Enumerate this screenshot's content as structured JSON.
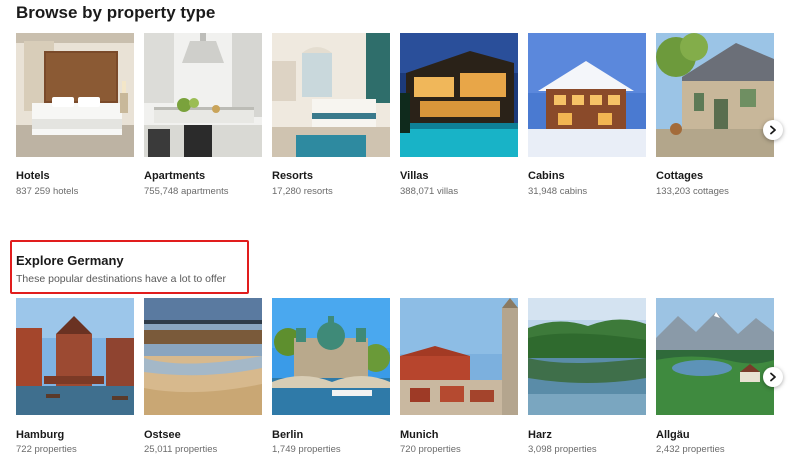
{
  "property_section": {
    "title": "Browse by property type",
    "cards": [
      {
        "name": "Hotels",
        "count": "837 259 hotels",
        "image": "hotel-room-photo"
      },
      {
        "name": "Apartments",
        "count": "755,748 apartments",
        "image": "apartment-kitchen-photo"
      },
      {
        "name": "Resorts",
        "count": "17,280 resorts",
        "image": "resort-room-photo"
      },
      {
        "name": "Villas",
        "count": "388,071 villas",
        "image": "villa-pool-night-photo"
      },
      {
        "name": "Cabins",
        "count": "31,948 cabins",
        "image": "snowy-cabin-photo"
      },
      {
        "name": "Cottages",
        "count": "133,203 cottages",
        "image": "stone-cottage-photo"
      }
    ],
    "next_icon": "chevron-right-icon"
  },
  "explore_section": {
    "title": "Explore Germany",
    "subtitle": "These popular destinations have a lot to offer",
    "highlight_color": "#e11d1d",
    "cards": [
      {
        "name": "Hamburg",
        "count": "722 properties",
        "image": "hamburg-photo"
      },
      {
        "name": "Ostsee",
        "count": "25,011 properties",
        "image": "ostsee-beach-photo"
      },
      {
        "name": "Berlin",
        "count": "1,749 properties",
        "image": "berlin-cathedral-photo"
      },
      {
        "name": "Munich",
        "count": "720 properties",
        "image": "munich-rooftops-photo"
      },
      {
        "name": "Harz",
        "count": "3,098 properties",
        "image": "harz-lake-photo"
      },
      {
        "name": "Allgäu",
        "count": "2,432 properties",
        "image": "allgaeu-mountains-photo"
      }
    ],
    "next_icon": "chevron-right-icon"
  }
}
